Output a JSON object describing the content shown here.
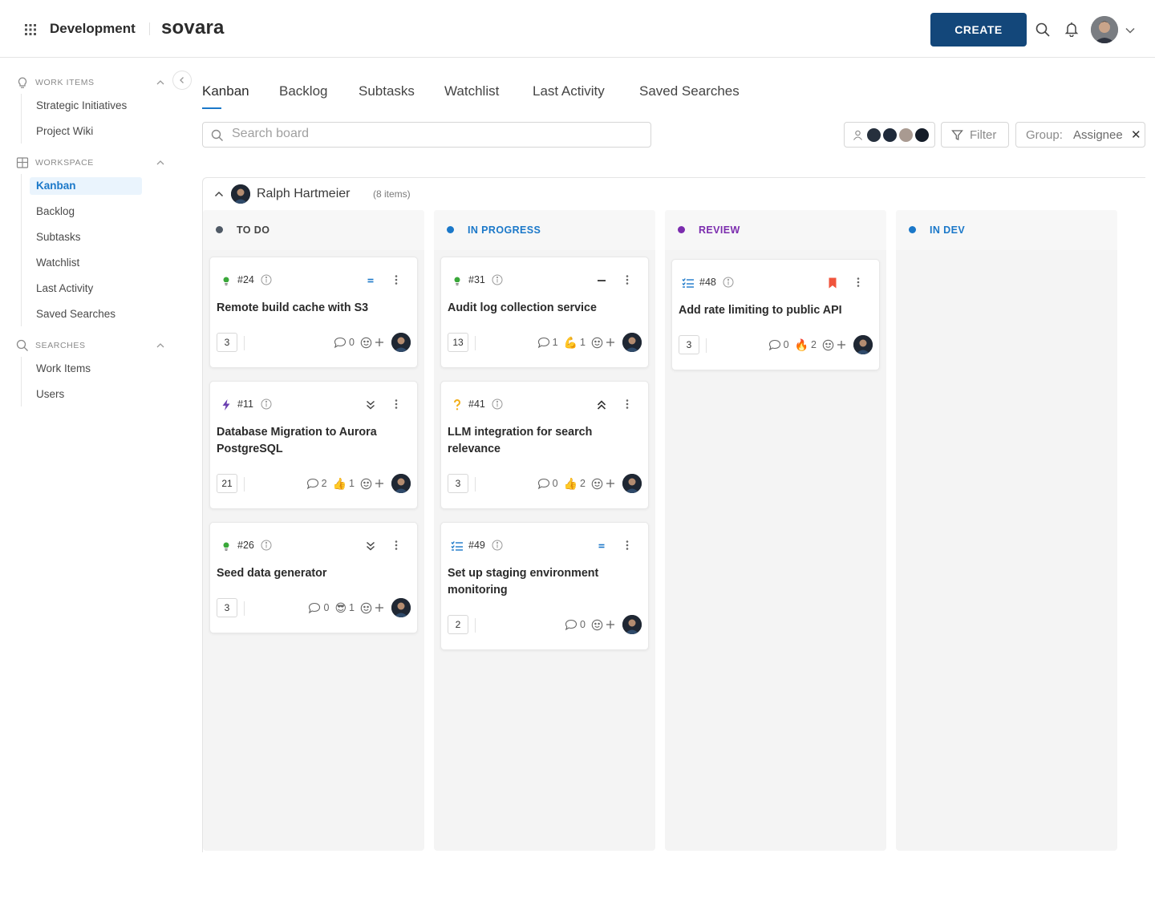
{
  "topbar": {
    "app_title": "Development",
    "brand": "sovara",
    "create_label": "CREATE",
    "icons": [
      "apps-grid-icon",
      "search-icon",
      "bell-icon",
      "chevron-down-icon"
    ]
  },
  "sidebar": {
    "sections": [
      {
        "title": "WORK ITEMS",
        "icon": "lightbulb-icon",
        "items": [
          "Strategic Initiatives",
          "Project Wiki"
        ]
      },
      {
        "title": "WORKSPACE",
        "icon": "board-icon",
        "items": [
          "Kanban",
          "Backlog",
          "Subtasks",
          "Watchlist",
          "Last Activity",
          "Saved Searches"
        ],
        "active": "Kanban"
      },
      {
        "title": "SEARCHES",
        "icon": "search-icon",
        "items": [
          "Work Items",
          "Users"
        ]
      }
    ]
  },
  "tabs": [
    "Kanban",
    "Backlog",
    "Subtasks",
    "Watchlist",
    "Last Activity",
    "Saved Searches"
  ],
  "active_tab": "Kanban",
  "toolbar": {
    "search_placeholder": "Search board",
    "filter_label": "Filter",
    "group_label": "Group:",
    "group_value": "Assignee",
    "group_clear": "✕"
  },
  "group": {
    "name": "Ralph Hartmeier",
    "count_label": "(8 items)"
  },
  "colors": {
    "primary": "#13477a",
    "accent": "#1b78c9",
    "todo": "#505a66",
    "in_progress": "#1b78c9",
    "review": "#7b2cae",
    "in_dev": "#1b78c9"
  },
  "columns": [
    {
      "title": "TO DO",
      "color": "#505a66",
      "cards": [
        {
          "type": "idea",
          "number": "#24",
          "priority": "medium",
          "title": "Remote build cache with S3",
          "estimate": "3",
          "comments": "0",
          "reactions": []
        },
        {
          "type": "lightning",
          "number": "#11",
          "priority": "lowest",
          "title": "Database Migration to Aurora PostgreSQL",
          "estimate": "21",
          "comments": "2",
          "reactions": [
            {
              "emoji": "👍",
              "count": "1"
            }
          ]
        },
        {
          "type": "idea",
          "number": "#26",
          "priority": "lowest",
          "title": "Seed data generator",
          "estimate": "3",
          "comments": "0",
          "reactions": [
            {
              "emoji": "😎",
              "count": "1"
            }
          ]
        }
      ]
    },
    {
      "title": "IN PROGRESS",
      "color": "#1b78c9",
      "cards": [
        {
          "type": "idea",
          "number": "#31",
          "priority": "minor",
          "title": "Audit log collection service",
          "estimate": "13",
          "comments": "1",
          "reactions": [
            {
              "emoji": "💪",
              "count": "1"
            }
          ]
        },
        {
          "type": "question",
          "number": "#41",
          "priority": "highest",
          "title": "LLM integration for search relevance",
          "estimate": "3",
          "comments": "0",
          "reactions": [
            {
              "emoji": "👍",
              "count": "2"
            }
          ]
        },
        {
          "type": "checklist",
          "number": "#49",
          "priority": "medium",
          "title": "Set up staging environment monitoring",
          "estimate": "2",
          "comments": "0",
          "reactions": []
        }
      ]
    },
    {
      "title": "REVIEW",
      "color": "#7b2cae",
      "cards": [
        {
          "type": "checklist",
          "number": "#48",
          "priority": "bookmark",
          "title": "Add rate limiting to public API",
          "estimate": "3",
          "comments": "0",
          "reactions": [
            {
              "emoji": "🔥",
              "count": "2"
            }
          ]
        }
      ]
    },
    {
      "title": "IN DEV",
      "color": "#1b78c9",
      "cards": []
    }
  ]
}
